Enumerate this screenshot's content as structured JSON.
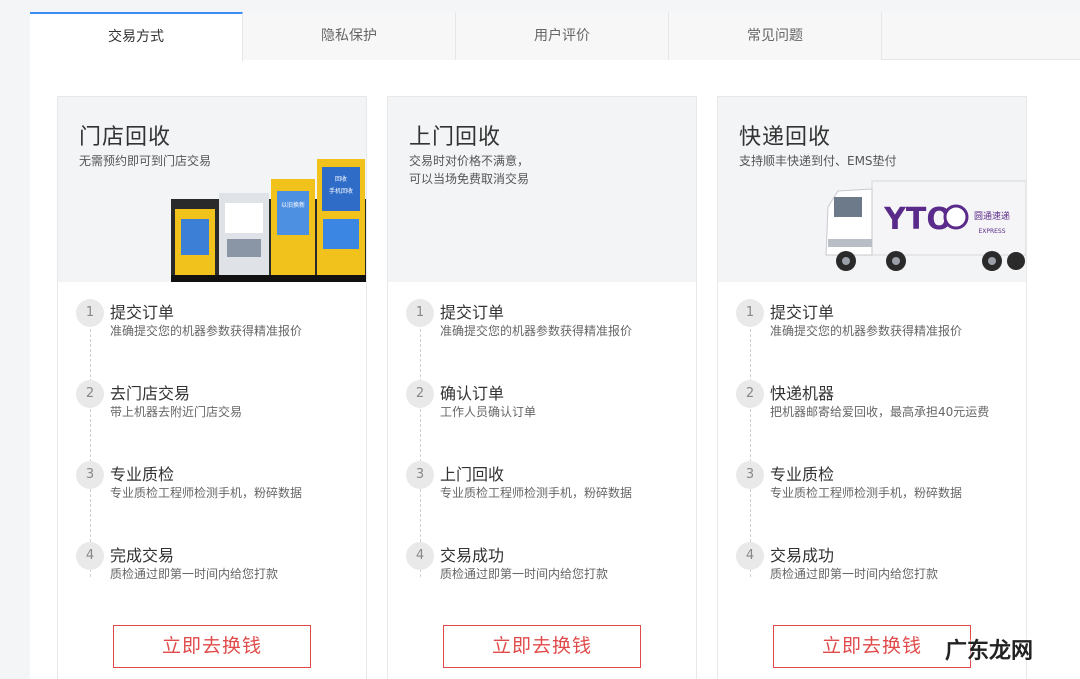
{
  "tabs": [
    {
      "label": "交易方式",
      "active": true
    },
    {
      "label": "隐私保护",
      "active": false
    },
    {
      "label": "用户评价",
      "active": false
    },
    {
      "label": "常见问题",
      "active": false
    }
  ],
  "cards": [
    {
      "title": "门店回收",
      "subtitle_lines": [
        "无需预约即可到门店交易"
      ],
      "image": "kiosk-machines",
      "steps": [
        {
          "num": "1",
          "title": "提交订单",
          "desc": "准确提交您的机器参数获得精准报价"
        },
        {
          "num": "2",
          "title": "去门店交易",
          "desc": "带上机器去附近门店交易"
        },
        {
          "num": "3",
          "title": "专业质检",
          "desc": "专业质检工程师检测手机，粉碎数据"
        },
        {
          "num": "4",
          "title": "完成交易",
          "desc": "质检通过即第一时间内给您打款"
        }
      ],
      "cta": "立即去换钱"
    },
    {
      "title": "上门回收",
      "subtitle_lines": [
        "交易时对价格不满意，",
        "可以当场免费取消交易"
      ],
      "image": "",
      "steps": [
        {
          "num": "1",
          "title": "提交订单",
          "desc": "准确提交您的机器参数获得精准报价"
        },
        {
          "num": "2",
          "title": "确认订单",
          "desc": "工作人员确认订单"
        },
        {
          "num": "3",
          "title": "上门回收",
          "desc": "专业质检工程师检测手机，粉碎数据"
        },
        {
          "num": "4",
          "title": "交易成功",
          "desc": "质检通过即第一时间内给您打款"
        }
      ],
      "cta": "立即去换钱"
    },
    {
      "title": "快递回收",
      "subtitle_lines": [
        "支持顺丰快递到付、EMS垫付"
      ],
      "image": "yto-express-truck",
      "steps": [
        {
          "num": "1",
          "title": "提交订单",
          "desc": "准确提交您的机器参数获得精准报价"
        },
        {
          "num": "2",
          "title": "快递机器",
          "desc": "把机器邮寄给爱回收，最高承担40元运费"
        },
        {
          "num": "3",
          "title": "专业质检",
          "desc": "专业质检工程师检测手机，粉碎数据"
        },
        {
          "num": "4",
          "title": "交易成功",
          "desc": "质检通过即第一时间内给您打款"
        }
      ],
      "cta": "立即去换钱"
    }
  ],
  "truck_logo": {
    "brand": "YTO",
    "cn": "圆通速递",
    "en": "EXPRESS"
  },
  "kiosk_text": {
    "a": "手机回收",
    "b": "以旧换新",
    "c": "回收"
  },
  "watermark": "广东龙网",
  "colors": {
    "accent": "#3b8ef2",
    "cta": "#e04a4a",
    "card_head_bg": "#f3f4f6"
  }
}
